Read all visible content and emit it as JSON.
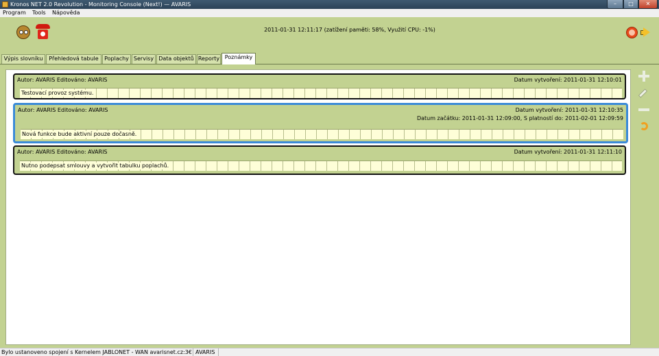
{
  "window": {
    "title": "Kronos NET 2.0 Revolution - Monitoring Console (Next!) — AVARIS",
    "minimize_label": "–",
    "maximize_label": "□",
    "close_label": "✕"
  },
  "menu": {
    "items": [
      {
        "label": "Program"
      },
      {
        "label": "Tools"
      },
      {
        "label": "Nápověda"
      }
    ]
  },
  "header": {
    "status": "2011-01-31 12:11:17 (zatížení paměti: 58%, Využití CPU: -1%)",
    "icons": [
      "owl-icon",
      "phone-icon",
      "sad-face-icon",
      "speaker-icon"
    ]
  },
  "tabs": [
    {
      "label": "Výpis slovníku"
    },
    {
      "label": "Přehledová tabule"
    },
    {
      "label": "Poplachy"
    },
    {
      "label": "Servisy"
    },
    {
      "label": "Data objektů"
    },
    {
      "label": "Reporty"
    },
    {
      "label": "Poznámky",
      "active": true
    }
  ],
  "notes": [
    {
      "author": "Autor: AVARIS  Editováno: AVARIS",
      "created": "Datum vytvoření: 2011-01-31 12:10:01",
      "text": "Testovací provoz systému."
    },
    {
      "author": "Autor: AVARIS  Editováno: AVARIS",
      "created": "Datum vytvoření: 2011-01-31 12:10:35",
      "validity": "Datum začátku: 2011-01-31 12:09:00, S platností do: 2011-02-01 12:09:59",
      "text": "Nová funkce bude aktivní pouze dočasně.",
      "selected": true
    },
    {
      "author": "Autor: AVARIS  Editováno: AVARIS",
      "created": "Datum vytvoření: 2011-01-31 12:11:10",
      "text": "Nutno podepsat smlouvy a vytvořit tabulku poplachů."
    }
  ],
  "side_actions": [
    "add-note",
    "edit-note",
    "remove-note",
    "undo"
  ],
  "statusbar": {
    "connection": "Bylo ustanoveno spojení s Kernelem JABLONET - WAN avarisnet.cz:3€",
    "user": "AVARIS"
  },
  "colors": {
    "background": "#c2d291",
    "note_body": "#fefed8",
    "selected_border": "#3a8ad8"
  }
}
